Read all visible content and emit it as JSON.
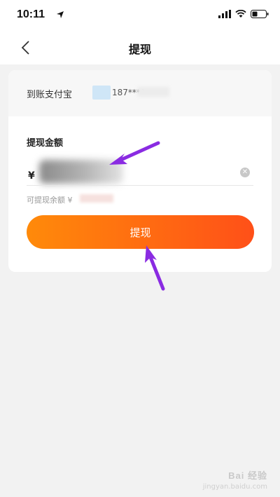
{
  "status_bar": {
    "time": "10:11"
  },
  "nav": {
    "title": "提现",
    "back_icon": "chevron-left-icon"
  },
  "destination": {
    "label": "到账支付宝",
    "account": "187****"
  },
  "amount": {
    "label": "提现金额",
    "currency": "¥",
    "clear_icon": "clear-icon"
  },
  "available": {
    "label": "可提现余额 ¥"
  },
  "withdraw_button": {
    "label": "提现"
  },
  "watermark": {
    "text": "Bai 经验",
    "sub": "jingyan.baidu.com"
  },
  "colors": {
    "button_start": "#ff8a0a",
    "button_end": "#ff5018",
    "annotation_arrow": "#8a2be2"
  }
}
